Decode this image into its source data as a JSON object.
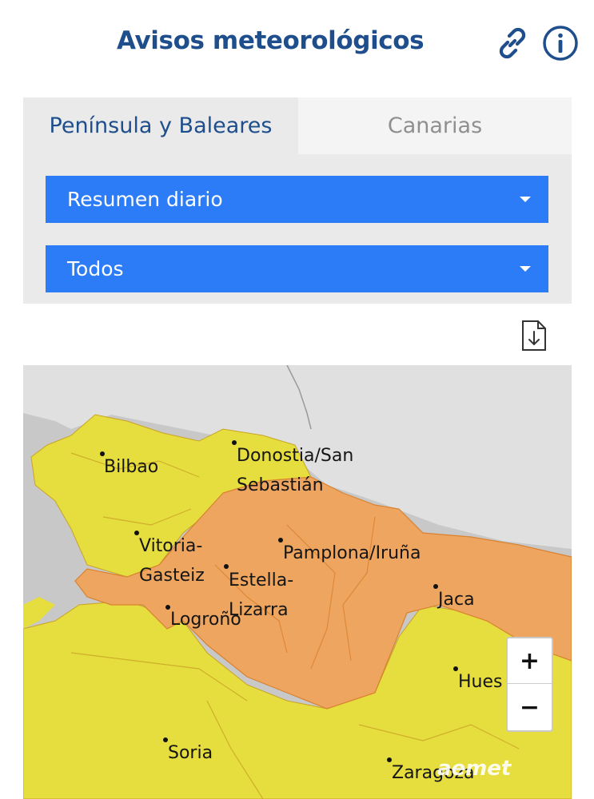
{
  "header": {
    "title": "Avisos meteorológicos",
    "link_icon": "link-icon",
    "info_icon": "info-icon"
  },
  "tabs": [
    {
      "label": "Península y Baleares",
      "active": true
    },
    {
      "label": "Canarias",
      "active": false
    }
  ],
  "selects": {
    "period": {
      "value": "Resumen diario"
    },
    "phenomenon": {
      "value": "Todos"
    }
  },
  "download_icon": "download-document-icon",
  "map": {
    "warning_colors": {
      "yellow": "#e5dd3f",
      "orange": "#eda65f",
      "land": "#cfcfcf",
      "sea": "#e0e0e0"
    },
    "cities": [
      {
        "id": "bilbao",
        "label": "Bilbao"
      },
      {
        "id": "donostia",
        "label": "Donostia/San\nSebastián"
      },
      {
        "id": "vitoria",
        "label": "Vitoria-\nGasteiz"
      },
      {
        "id": "pamplona",
        "label": "Pamplona/Iruña"
      },
      {
        "id": "estella",
        "label": "Estella-\nLizarra"
      },
      {
        "id": "logrono",
        "label": "Logroño"
      },
      {
        "id": "jaca",
        "label": "Jaca"
      },
      {
        "id": "huesca",
        "label": "Hues"
      },
      {
        "id": "soria",
        "label": "Soria"
      },
      {
        "id": "zaragoza",
        "label": "Zaragoza"
      }
    ],
    "zoom_in": "+",
    "zoom_out": "−",
    "watermark": "aemet"
  },
  "colors": {
    "title": "#1f4e8c",
    "select_bg": "#2b7cf6",
    "panel_bg": "#eaeaea"
  }
}
